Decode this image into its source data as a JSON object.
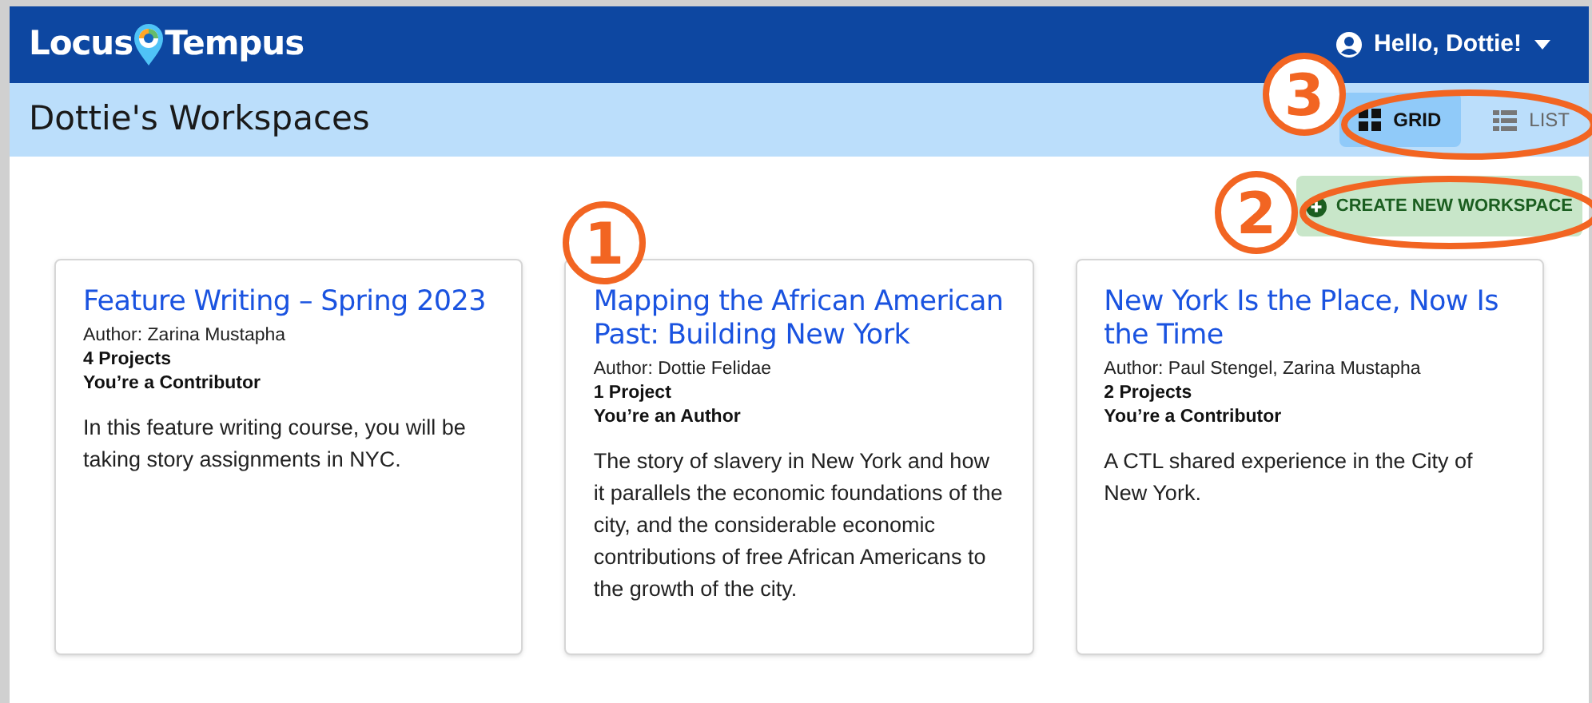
{
  "header": {
    "logo_left": "Locus",
    "logo_right": "Tempus",
    "greeting": "Hello, Dottie!"
  },
  "toolbar": {
    "title": "Dottie's Workspaces",
    "view_options": [
      {
        "label": "GRID",
        "kind": "grid",
        "selected": true
      },
      {
        "label": "LIST",
        "kind": "list",
        "selected": false
      }
    ]
  },
  "create_button": "CREATE NEW WORKSPACE",
  "workspaces": [
    {
      "title": "Feature Writing – Spring 2023",
      "author": "Author: Zarina Mustapha",
      "projects": "4 Projects",
      "role": "You’re a Contributor",
      "description": "In this feature writing course, you will be taking story assignments in NYC."
    },
    {
      "title": "Mapping the African American Past: Building New York",
      "author": "Author: Dottie Felidae",
      "projects": "1 Project",
      "role": "You’re an Author",
      "description": "The story of slavery in New York and how it parallels the economic foundations of the city, and the considerable economic contributions of free African Americans to the growth of the city."
    },
    {
      "title": "New York Is the Place, Now Is the Time",
      "author": "Author: Paul Stengel, Zarina Mustapha",
      "projects": "2 Projects",
      "role": "You’re a Contributor",
      "description": "A CTL shared experience in the City of New York."
    }
  ],
  "callouts": [
    {
      "number": "1",
      "kind": "card"
    },
    {
      "number": "2",
      "kind": "create"
    },
    {
      "number": "3",
      "kind": "view"
    }
  ]
}
